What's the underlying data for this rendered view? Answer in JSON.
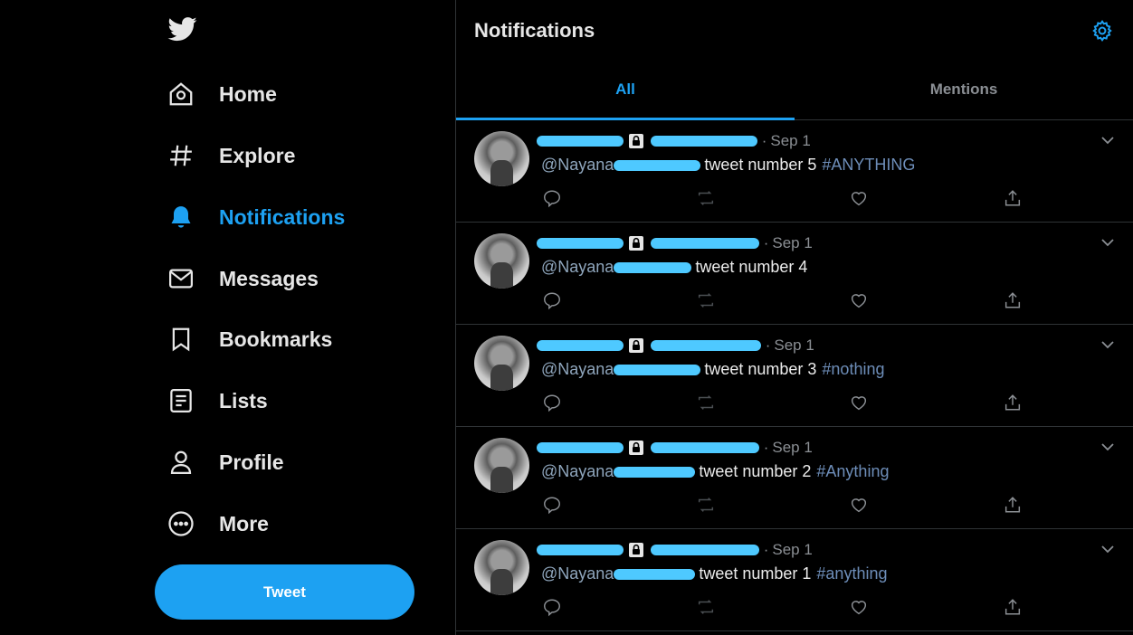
{
  "nav": {
    "items": [
      {
        "label": "Home",
        "icon": "home-icon"
      },
      {
        "label": "Explore",
        "icon": "hashtag-icon"
      },
      {
        "label": "Notifications",
        "icon": "bell-icon",
        "active": true
      },
      {
        "label": "Messages",
        "icon": "mail-icon"
      },
      {
        "label": "Bookmarks",
        "icon": "bookmark-icon"
      },
      {
        "label": "Lists",
        "icon": "list-icon"
      },
      {
        "label": "Profile",
        "icon": "person-icon"
      },
      {
        "label": "More",
        "icon": "more-circle-icon"
      }
    ],
    "tweet_label": "Tweet"
  },
  "header": {
    "title": "Notifications"
  },
  "tabs": [
    {
      "label": "All",
      "active": true
    },
    {
      "label": "Mentions",
      "active": false
    }
  ],
  "notifications": [
    {
      "date": "Sep 1",
      "mention": "@Nayana",
      "text": "tweet number 5",
      "hashtag": "#ANYTHING"
    },
    {
      "date": "Sep 1",
      "mention": "@Nayana",
      "text": "tweet number 4",
      "hashtag": ""
    },
    {
      "date": "Sep 1",
      "mention": "@Nayana",
      "text": "tweet number 3",
      "hashtag": "#nothing"
    },
    {
      "date": "Sep 1",
      "mention": "@Nayana",
      "text": "tweet number 2",
      "hashtag": "#Anything"
    },
    {
      "date": "Sep 1",
      "mention": "@Nayana",
      "text": "tweet number 1",
      "hashtag": "#anything"
    }
  ],
  "colors": {
    "accent": "#1da1f2",
    "background": "#000000",
    "redaction": "#4ec9ff"
  }
}
